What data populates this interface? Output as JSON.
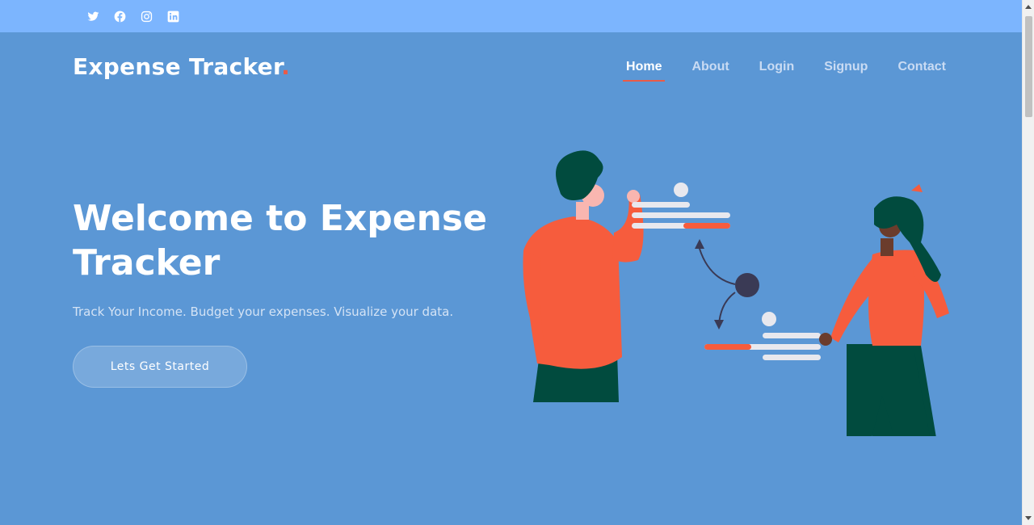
{
  "social": [
    {
      "icon": "twitter-icon"
    },
    {
      "icon": "facebook-icon"
    },
    {
      "icon": "instagram-icon"
    },
    {
      "icon": "linkedin-icon"
    }
  ],
  "header": {
    "logo_text": "Expense Tracker",
    "logo_dot": "."
  },
  "nav": {
    "items": [
      "Home",
      "About",
      "Login",
      "Signup",
      "Contact"
    ],
    "active": "Home"
  },
  "hero": {
    "title": "Welcome to Expense Tracker",
    "subtitle": "Track Your Income. Budget your expenses. Visualize your data.",
    "cta_label": "Lets Get Started"
  },
  "colors": {
    "topbar": "#7cb5fe",
    "background": "#5b97d5",
    "accent": "#ea5b47",
    "person_shirt": "#f65c3d",
    "person_pants": "#014b3e"
  }
}
